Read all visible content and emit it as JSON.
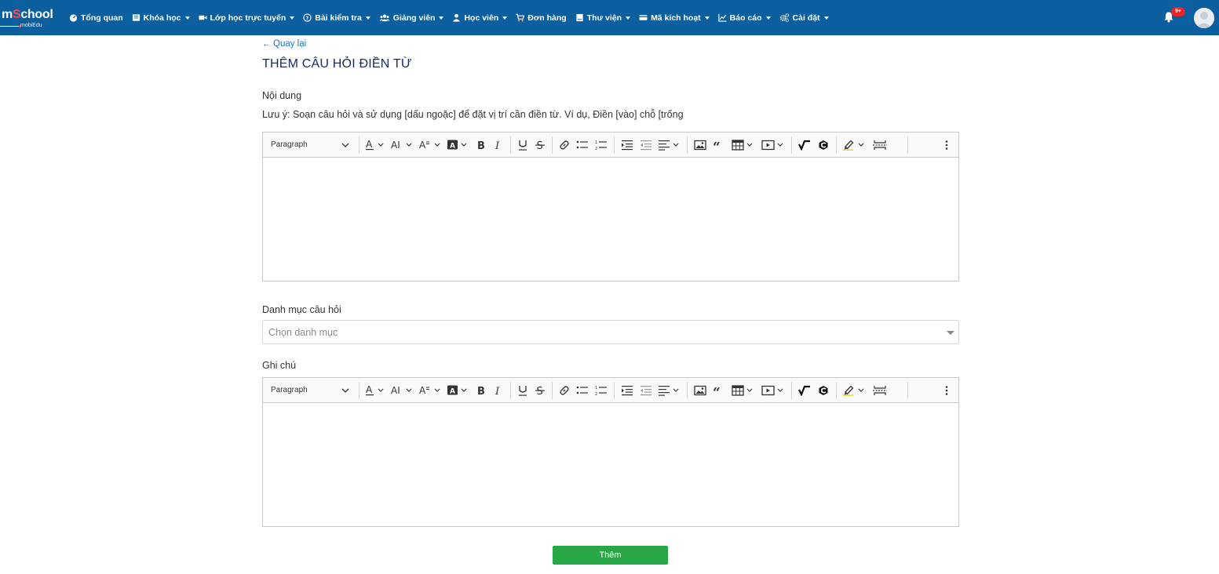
{
  "logo": {
    "brand_prefix": "m",
    "brand_s": "S",
    "brand_suffix": "chool",
    "sub": "mobiEdu"
  },
  "nav": {
    "items": [
      {
        "icon": "dashboard-icon",
        "label": "Tổng quan",
        "caret": false
      },
      {
        "icon": "book-icon",
        "label": "Khóa học",
        "caret": true
      },
      {
        "icon": "video-camera-icon",
        "label": "Lớp học trực tuyến",
        "caret": true
      },
      {
        "icon": "question-circle-icon",
        "label": "Bài kiểm tra",
        "caret": true
      },
      {
        "icon": "users-icon",
        "label": "Giảng viên",
        "caret": true
      },
      {
        "icon": "user-icon",
        "label": "Học viên",
        "caret": true
      },
      {
        "icon": "cart-icon",
        "label": "Đơn hàng",
        "caret": false
      },
      {
        "icon": "library-icon",
        "label": "Thư viện",
        "caret": true
      },
      {
        "icon": "barcode-icon",
        "label": "Mã kích hoạt",
        "caret": true
      },
      {
        "icon": "line-chart-icon",
        "label": "Báo cáo",
        "caret": true
      },
      {
        "icon": "cogs-icon",
        "label": "Cài đặt",
        "caret": true
      }
    ]
  },
  "notifications": {
    "badge": "9+"
  },
  "page": {
    "back": "Quay lại",
    "title": "THÊM CÂU HỎI ĐIỀN TỪ",
    "content_label": "Nội dung",
    "note": "Lưu ý: Soạn câu hỏi và sử dụng [dấu ngoặc] để đặt vị trí cần điền từ. Ví dụ, Điền [vào] chỗ [trống",
    "category_label": "Danh mục câu hỏi",
    "category_placeholder": "Chọn danh mục",
    "notes_label": "Ghi chú",
    "submit": "Thêm"
  },
  "editor": {
    "paragraph": "Paragraph"
  }
}
